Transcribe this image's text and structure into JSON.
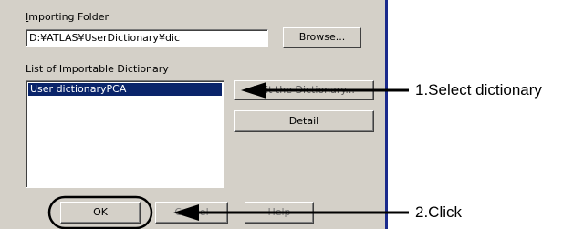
{
  "dialog": {
    "importing_folder_label": "Importing Folder",
    "folder_path": "D:¥ATLAS¥UserDictionary¥dic",
    "browse_label": "Browse...",
    "list_label": "List of Importable Dictionary",
    "list_items": [
      "User dictionaryPCA"
    ],
    "edit_dictionary_label": "Edit the Dictionary...",
    "detail_label": "Detail",
    "ok_label": "OK",
    "cancel_label": "Cancel",
    "help_label": "Help"
  },
  "annotations": {
    "step1": "1.Select dictionary",
    "step2": "2.Click"
  }
}
